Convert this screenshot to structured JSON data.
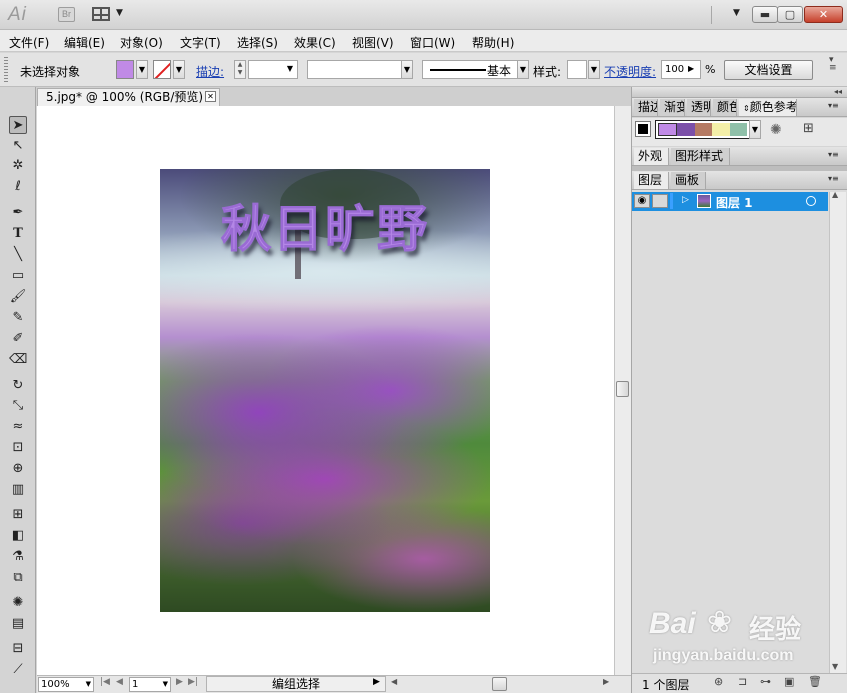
{
  "app": {
    "logo": "Ai",
    "bridge": "Br"
  },
  "menu": [
    "文件(F)",
    "编辑(E)",
    "对象(O)",
    "文字(T)",
    "选择(S)",
    "效果(C)",
    "视图(V)",
    "窗口(W)",
    "帮助(H)"
  ],
  "control": {
    "selection": "未选择对象",
    "stroke_label": "描边:",
    "brush": "基本",
    "style_label": "样式:",
    "opacity_label": "不透明度:",
    "opacity": "100",
    "percent": "%",
    "doc_setup": "文档设置"
  },
  "doc_tab": "5.jpg* @ 100% (RGB/预览)",
  "artwork_title": "秋日旷野",
  "status": {
    "zoom": "100%",
    "page": "1",
    "mode": "编组选择"
  },
  "panels": {
    "top_tabs": [
      "描边",
      "渐变",
      "透明",
      "颜色",
      "颜色参考"
    ],
    "appearance_tabs": [
      "外观",
      "图形样式"
    ],
    "layer_tabs": [
      "图层",
      "画板"
    ],
    "layer_name": "图层 1",
    "layer_count": "1 个图层"
  },
  "harmony_colors": [
    "#c08ae6",
    "#7b4fa8",
    "#b57a63",
    "#f4efa8",
    "#8fc0a9"
  ],
  "watermark": {
    "logo": "Bai",
    "domain_cn": "经验",
    "url": "jingyan.baidu.com"
  }
}
